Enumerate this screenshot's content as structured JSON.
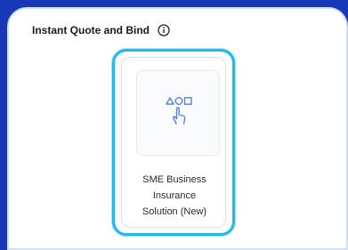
{
  "section": {
    "title": "Instant Quote and Bind",
    "info_icon": "info-icon"
  },
  "product_card": {
    "icon": "touch-shapes-icon",
    "label_lines": [
      "SME Business",
      "Insurance",
      "Solution (New)"
    ]
  },
  "colors": {
    "background": "#1739b9",
    "highlight_border": "#22b8f0",
    "icon_stroke": "#5b7fd6"
  }
}
